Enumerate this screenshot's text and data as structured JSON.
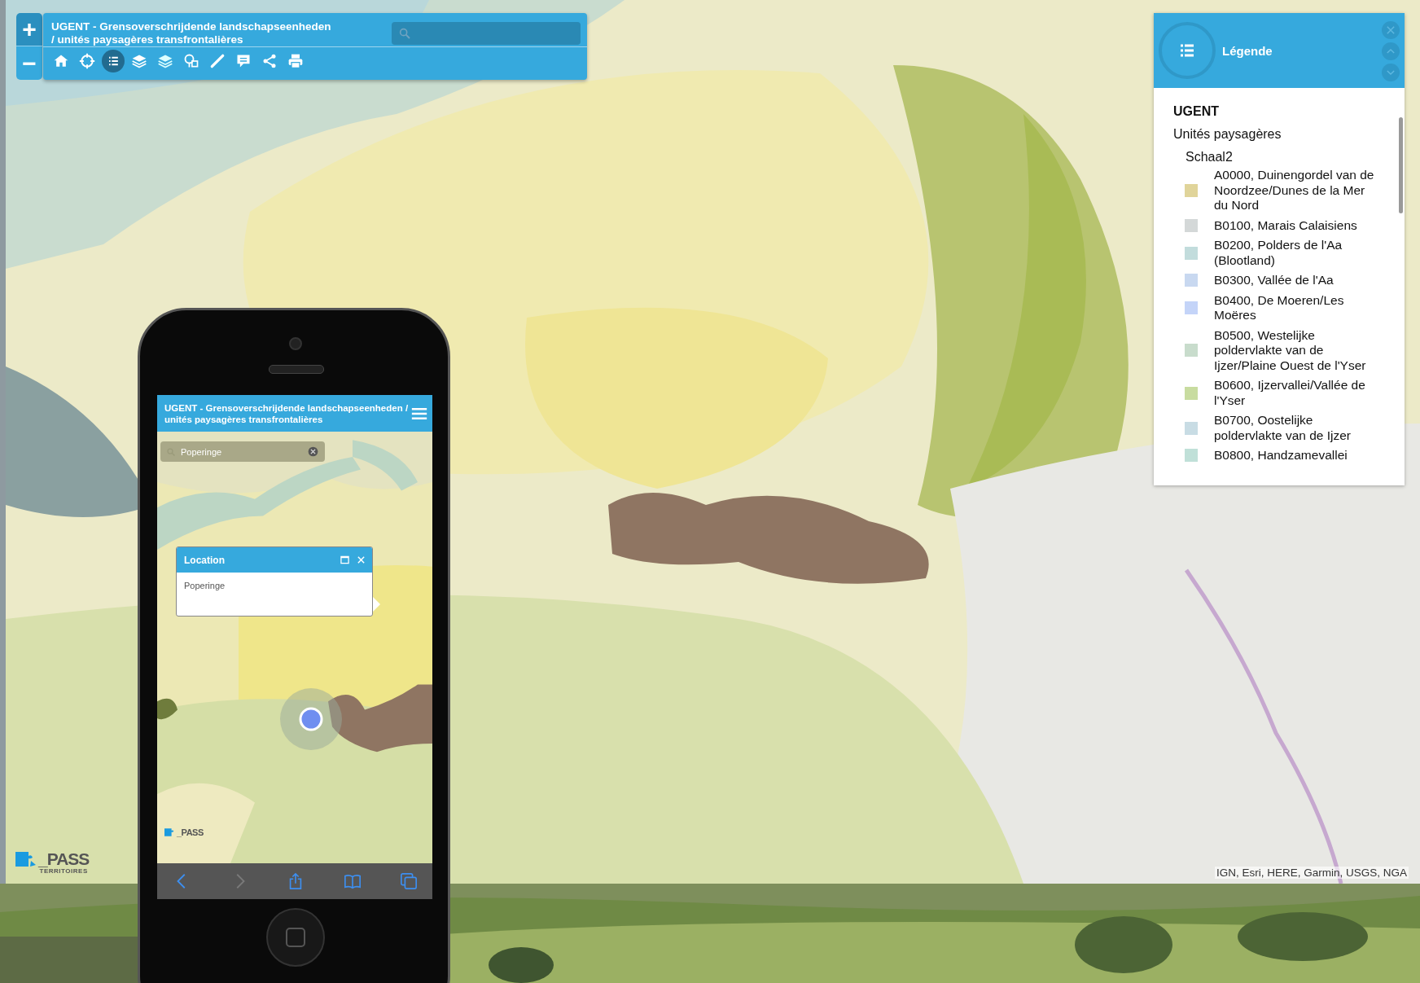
{
  "zoom_controls": [
    "+",
    "−"
  ],
  "toolbar": {
    "title": "UGENT - Grensoverschrijdende landschapseenheden / unités paysagères transfrontalières",
    "tools": [
      {
        "kind": "home",
        "selected": false
      },
      {
        "kind": "locate",
        "selected": false
      },
      {
        "kind": "legend",
        "selected": true
      },
      {
        "kind": "layers",
        "selected": false
      },
      {
        "kind": "basemap",
        "selected": false
      },
      {
        "kind": "identify",
        "selected": false
      },
      {
        "kind": "measure",
        "selected": false
      },
      {
        "kind": "comment",
        "selected": false
      },
      {
        "kind": "share",
        "selected": false
      },
      {
        "kind": "print",
        "selected": false
      }
    ]
  },
  "legend": {
    "title": "Légende",
    "group": "UGENT",
    "layer": "Unités paysagères",
    "sublayer": "Schaal2",
    "items": [
      {
        "label": "A0000, Duinengordel van de Noordzee/Dunes de la Mer du Nord",
        "color": "#e0d49a"
      },
      {
        "label": "B0100, Marais Calaisiens",
        "color": "#d4d8d8"
      },
      {
        "label": "B0200, Polders de l'Aa (Blootland)",
        "color": "#c2dcdc"
      },
      {
        "label": "B0300, Vallée de l'Aa",
        "color": "#c8d8f0"
      },
      {
        "label": "B0400, De Moeren/Les Moëres",
        "color": "#c4d4f8"
      },
      {
        "label": "B0500, Westelijke poldervlakte van de Ijzer/Plaine Ouest de l'Yser",
        "color": "#c8dccc"
      },
      {
        "label": "B0600, Ijzervallei/Vallée de l'Yser",
        "color": "#c8dca0"
      },
      {
        "label": "B0700, Oostelijke poldervlakte van de Ijzer",
        "color": "#c8dce4"
      },
      {
        "label": "B0800, Handzamevallei",
        "color": "#c0e0d8"
      }
    ]
  },
  "logo": {
    "name": "_PASS",
    "subtitle": "TERRITOIRES"
  },
  "attribution": "IGN, Esri, HERE, Garmin, USGS, NGA",
  "phone": {
    "title": "UGENT - Grensoverschrijdende landschapseenheden / unités paysagères transfrontalières",
    "search": {
      "value": "Poperinge"
    },
    "popup": {
      "title": "Location",
      "body": "Poperinge"
    },
    "logo": {
      "name": "_PASS"
    },
    "browser_buttons": [
      {
        "kind": "back",
        "disabled": false
      },
      {
        "kind": "forward",
        "disabled": true
      },
      {
        "kind": "share",
        "disabled": false
      },
      {
        "kind": "bookmarks",
        "disabled": false
      },
      {
        "kind": "tabs",
        "disabled": false
      }
    ]
  }
}
